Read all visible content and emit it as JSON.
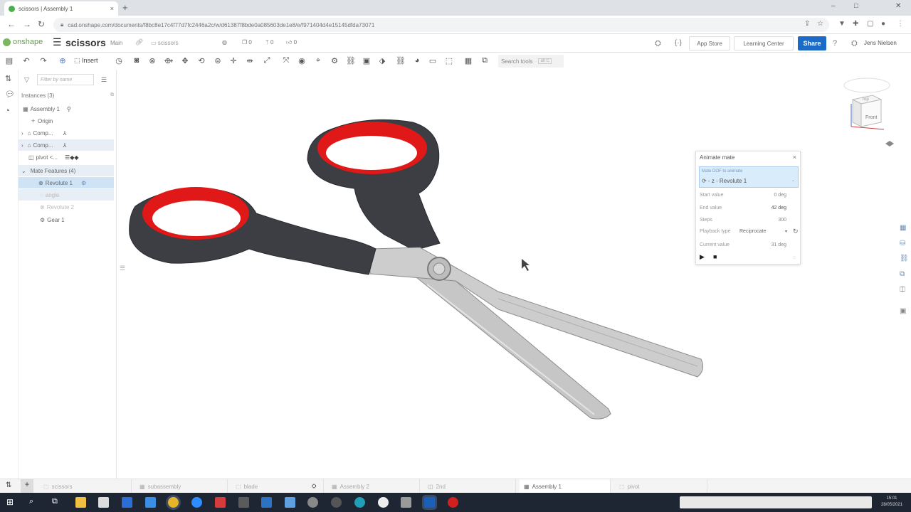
{
  "browser": {
    "tab_title": "scissors | Assembly 1",
    "tab_close": "×",
    "new_tab": "+",
    "url": "cad.onshape.com/documents/f8bc8e17c4f77d7fc2446a2c/w/d61387f8bde0a085603de1e8/e/f971404d4e15145dfda73071",
    "window_controls": [
      "–",
      "□",
      "✕"
    ]
  },
  "header": {
    "logo": "onshape",
    "doc_name": "scissors",
    "branch": "Main",
    "folder": "scissors",
    "versions_count": "0",
    "branches_count": "0",
    "likes_count": "0",
    "app_store": "App Store",
    "learning_center": "Learning Center",
    "share": "Share",
    "user": "Jens Nielsen"
  },
  "toolbar": {
    "insert_label": "Insert",
    "search_tools": "Search tools",
    "search_shortcut": "alt C"
  },
  "feature_panel": {
    "filter_placeholder": "Filter by name",
    "instances_header": "Instances (3)",
    "assembly": "Assembly 1",
    "origin": "Origin",
    "comp1": "Comp...",
    "comp2": "Comp...",
    "pivot": "pivot <...",
    "mate_features": "Mate Features (4)",
    "revolute1": "Revolute 1",
    "angle": "angle",
    "revolute2": "Revolute 2",
    "gear1": "Gear 1"
  },
  "animate_dialog": {
    "title": "Animate mate",
    "mate_label": "Mate DOF to animate",
    "mate_value": "⟳ - z - Revolute 1",
    "start_label": "Start value",
    "start_value": "0 deg",
    "end_label": "End value",
    "end_value": "42 deg",
    "steps_label": "Steps",
    "steps_value": "300",
    "playback_label": "Playback type",
    "playback_value": "Reciprocate",
    "current_label": "Current value",
    "current_value": "31 deg"
  },
  "viewcube": {
    "front": "Front",
    "top": "Top"
  },
  "bottom_tabs": [
    "scissors",
    "subassembly",
    "blade",
    "Assembly 2",
    "2nd",
    "Assembly 1",
    "pivot"
  ],
  "taskbar": {
    "time": "15:01",
    "date": "28/05/2021"
  },
  "colors": {
    "share_blue": "#1c6cc7",
    "handle_red": "#e01818",
    "handle_black": "#3c3e44",
    "blade_gray": "#c9c9c9",
    "selected_row": "#cfe3f7"
  }
}
